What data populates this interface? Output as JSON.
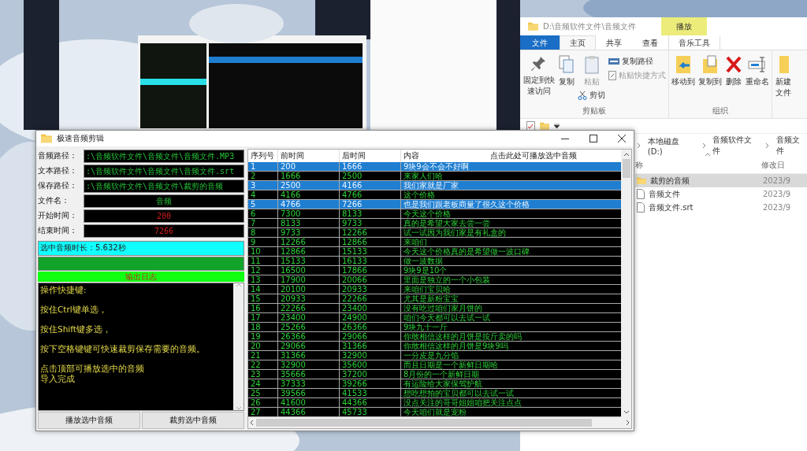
{
  "explorer": {
    "title": "D:\\音频软件文件\\音频文件",
    "context_label": "播放",
    "tabs": [
      {
        "label": "文件",
        "kind": "file",
        "selected": false
      },
      {
        "label": "主页",
        "kind": "normal",
        "selected": true
      },
      {
        "label": "共享",
        "kind": "normal",
        "selected": false
      },
      {
        "label": "查看",
        "kind": "normal",
        "selected": false
      },
      {
        "label": "音乐工具",
        "kind": "contextual",
        "selected": false
      }
    ],
    "clipboard": {
      "group": "剪贴板",
      "pin": {
        "label": "固定到快速访问",
        "disabled": false
      },
      "copy": {
        "label": "复制",
        "disabled": false
      },
      "paste": {
        "label": "粘贴",
        "disabled": true
      },
      "cut": {
        "label": "剪切",
        "disabled": false
      },
      "copy_path": {
        "label": "复制路径",
        "disabled": false
      },
      "paste_shortcut": {
        "label": "粘贴快捷方式",
        "disabled": true
      }
    },
    "organize": {
      "group": "组织",
      "move_to": "移动到",
      "copy_to": "复制到",
      "delete": "删除",
      "rename": "重命名"
    },
    "new_folder": "新建文件",
    "breadcrumb": [
      "本地磁盘 (D:)",
      "音频软件文件",
      "音频文件"
    ],
    "columns": [
      "称",
      "修改日"
    ],
    "files": [
      {
        "name": "裁剪的音频",
        "date": "2023/9",
        "kind": "folder",
        "selected": true
      },
      {
        "name": "音频文件",
        "date": "2023/9",
        "kind": "file",
        "selected": false
      },
      {
        "name": "音频文件.srt",
        "date": "2023/9",
        "kind": "file",
        "selected": false
      }
    ]
  },
  "app": {
    "title": "极速音频剪辑",
    "fields": [
      {
        "label": "音频路径：",
        "value": ":\\音频软件文件\\音频文件\\音频文件.MP3",
        "kind": "path"
      },
      {
        "label": "文本路径：",
        "value": ":\\音频软件文件\\音频文件\\音频文件.srt",
        "kind": "path"
      },
      {
        "label": "保存路径：",
        "value": ":\\音频软件文件\\音频文件\\裁剪的音频",
        "kind": "path"
      },
      {
        "label": "文件名：",
        "value": "音频",
        "kind": "name"
      },
      {
        "label": "开始时间：",
        "value": "200",
        "kind": "time"
      },
      {
        "label": "结束时间：",
        "value": "7266",
        "kind": "time"
      }
    ],
    "duration": "选中音频时长：5.632秒",
    "progress": {
      "level": 1
    },
    "log_title": "输出日志",
    "log": [
      [
        "操作快捷键:"
      ],
      [
        "按住Ctrl键单选，"
      ],
      [
        "按住Shift键多选，"
      ],
      [
        "按下空格键键可快速裁剪保存需要的音频。"
      ],
      [
        "点击顶部可播放选中的音频",
        "导入完成"
      ]
    ],
    "buttons": [
      "播放选中音频",
      "裁剪选中音频"
    ],
    "table": {
      "columns": [
        "序列号",
        "前时间",
        "后时间",
        "内容"
      ],
      "hint": "点击此处可播放选中音频",
      "rows": [
        {
          "cells": [
            "1",
            "200",
            "1666",
            "9块9会不会不好啊"
          ],
          "selected": true
        },
        {
          "cells": [
            "2",
            "1666",
            "2500",
            "来家人们哈"
          ],
          "selected": false
        },
        {
          "cells": [
            "3",
            "2500",
            "4166",
            "我们家就是厂家"
          ],
          "selected": true
        },
        {
          "cells": [
            "4",
            "4166",
            "4766",
            "这个价格"
          ],
          "selected": false
        },
        {
          "cells": [
            "5",
            "4766",
            "7266",
            "也是我们跟老板商量了很久这个价格"
          ],
          "selected": true
        },
        {
          "cells": [
            "6",
            "7300",
            "8133",
            "今天这个价格"
          ],
          "selected": false
        },
        {
          "cells": [
            "7",
            "8133",
            "9733",
            "真的是希望大家去尝一尝"
          ],
          "selected": false
        },
        {
          "cells": [
            "8",
            "9733",
            "12266",
            "试一试因为我们家是有礼盒的"
          ],
          "selected": false
        },
        {
          "cells": [
            "9",
            "12266",
            "12866",
            "来咱们"
          ],
          "selected": false
        },
        {
          "cells": [
            "10",
            "12866",
            "15133",
            "今天这个价格真的是希望做一波口碑"
          ],
          "selected": false
        },
        {
          "cells": [
            "11",
            "15133",
            "16133",
            "做一波数据"
          ],
          "selected": false
        },
        {
          "cells": [
            "12",
            "16500",
            "17866",
            "9块9是10个"
          ],
          "selected": false
        },
        {
          "cells": [
            "13",
            "17900",
            "20066",
            "里面是独立的一个小包装"
          ],
          "selected": false
        },
        {
          "cells": [
            "14",
            "20100",
            "20933",
            "来咱们宝贝哈"
          ],
          "selected": false
        },
        {
          "cells": [
            "15",
            "20933",
            "22266",
            "尤其是新粉宝宝"
          ],
          "selected": false
        },
        {
          "cells": [
            "16",
            "22266",
            "23400",
            "没有吃过咱们家月饼的"
          ],
          "selected": false
        },
        {
          "cells": [
            "17",
            "23400",
            "24900",
            "咱们今天都可以去试一试"
          ],
          "selected": false
        },
        {
          "cells": [
            "18",
            "25266",
            "26366",
            "9块九十一斤"
          ],
          "selected": false
        },
        {
          "cells": [
            "19",
            "26366",
            "29066",
            "你敢相信这样的月饼是按斤卖的吗"
          ],
          "selected": false
        },
        {
          "cells": [
            "20",
            "29066",
            "31366",
            "你敢相信这样的月饼是9块9吗"
          ],
          "selected": false
        },
        {
          "cells": [
            "21",
            "31366",
            "32900",
            "一分皮是九分馅"
          ],
          "selected": false
        },
        {
          "cells": [
            "22",
            "32900",
            "35600",
            "而且日期是一个新鲜日期哈"
          ],
          "selected": false
        },
        {
          "cells": [
            "23",
            "35666",
            "37200",
            "8月份的一个新鲜日期"
          ],
          "selected": false
        },
        {
          "cells": [
            "24",
            "37333",
            "39266",
            "有运险给大家保驾护航"
          ],
          "selected": false
        },
        {
          "cells": [
            "25",
            "39566",
            "41533",
            "想吃想拍的宝贝都可以去试一试"
          ],
          "selected": false
        },
        {
          "cells": [
            "26",
            "41600",
            "44366",
            "没点关注的哥哥姐姐咱把关注点点"
          ],
          "selected": false
        },
        {
          "cells": [
            "27",
            "44366",
            "45733",
            "今天咱们就是宠粉"
          ],
          "selected": false
        }
      ]
    }
  }
}
